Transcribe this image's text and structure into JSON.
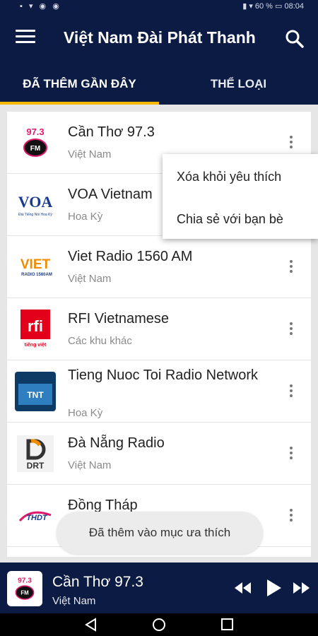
{
  "status_bar": {
    "left_icons": "▪ ▾ ◉ ◉",
    "right_text": "▮ ▾ 60 % ▭ 08:04"
  },
  "app": {
    "title": "Việt Nam Đài Phát Thanh"
  },
  "tabs": [
    {
      "label": "ĐÃ THÊM GẦN ĐÂY",
      "active": true
    },
    {
      "label": "THỂ LOẠI",
      "active": false
    }
  ],
  "stations": [
    {
      "name": "Cần Thơ 97.3",
      "country": "Việt Nam",
      "logo_text": "97.3",
      "logo_sub": "FM",
      "logo_icon": "can-tho-fm-logo"
    },
    {
      "name": "VOA Vietnam",
      "country": "Hoa Kỳ",
      "logo_text": "VOA",
      "logo_sub": "Đài Tiếng Nói Hoa Kỳ",
      "logo_icon": "voa-logo"
    },
    {
      "name": "Viet Radio 1560 AM",
      "country": "Việt Nam",
      "logo_text": "VIET",
      "logo_sub": "RADIO 1560AM",
      "logo_icon": "viet-radio-logo"
    },
    {
      "name": "RFI Vietnamese",
      "country": "Các khu khác",
      "logo_text": "rfi",
      "logo_sub": "tiếng việt",
      "logo_icon": "rfi-logo"
    },
    {
      "name": "Tieng Nuoc Toi Radio Network",
      "country": "Hoa Kỳ",
      "logo_text": "TNT",
      "logo_sub": "",
      "logo_icon": "tnt-logo"
    },
    {
      "name": "Đà Nẵng Radio",
      "country": "Việt Nam",
      "logo_text": "DRT",
      "logo_sub": "",
      "logo_icon": "drt-logo"
    },
    {
      "name": "Đồng Tháp",
      "country": "",
      "logo_text": "THDT",
      "logo_sub": "",
      "logo_icon": "dong-thap-logo"
    }
  ],
  "context_menu": {
    "remove_favorite": "Xóa khỏi yêu thích",
    "share": "Chia sẻ với bạn bè"
  },
  "toast": {
    "message": "Đã thêm vào mục ưa thích"
  },
  "player": {
    "title": "Cần Thơ 97.3",
    "subtitle": "Việt Nam",
    "logo_text": "97.3",
    "logo_sub": "FM"
  },
  "colors": {
    "primary": "#0b1b44",
    "accent": "#f5b800"
  }
}
